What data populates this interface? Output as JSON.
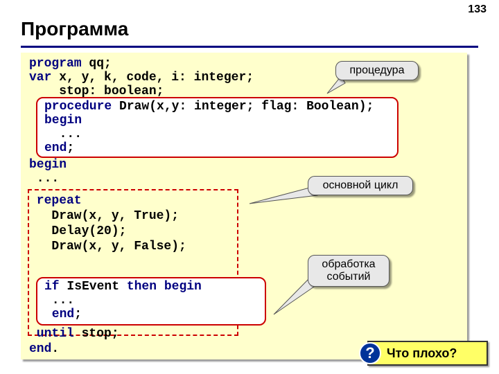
{
  "page_number": "133",
  "title": "Программа",
  "callouts": {
    "procedure": "процедура",
    "main_loop": "основной цикл",
    "events": "обработка\nсобытий"
  },
  "question": {
    "mark": "?",
    "text": "Что плохо?"
  },
  "code": {
    "l1_kw": "program ",
    "l1_tx": "qq;",
    "l2_kw": "var ",
    "l2_tx": "x, y, k, code, i: integer;",
    "l3_tx": "    stop: boolean;",
    "p1_kw": "procedure ",
    "p1_tx": "Draw(x,y: integer; flag: Boolean);",
    "p2_kw": "begin",
    "p3_tx": "  ...",
    "p4_kw": "end",
    "p4_tx": ";",
    "l4_kw": "begin",
    "l5_tx": " ...",
    "l6_kw": " repeat",
    "l7_tx": "   Draw(x, y, True);",
    "l8_tx": "   Delay(20);",
    "l9_tx": "   Draw(x, y, False);",
    "e1_kw1": "if ",
    "e1_tx": "IsEvent ",
    "e1_kw2": "then begin",
    "e2_tx": " ...",
    "e3_kw": " end",
    "e3_tx": ";",
    "l10_kw": " until ",
    "l10_tx": "stop;",
    "l11_kw": "end",
    "l11_tx": "."
  }
}
